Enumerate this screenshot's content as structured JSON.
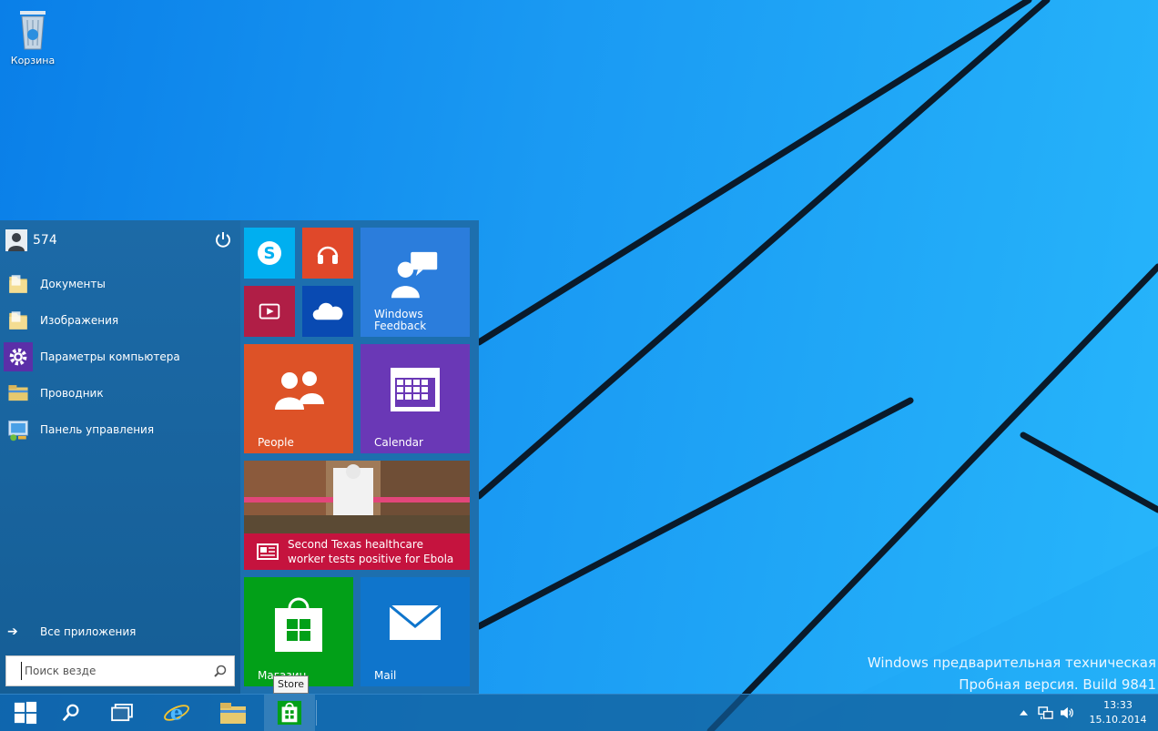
{
  "desktop": {
    "recycle_bin_label": "Корзина",
    "watermark_line1": "Windows предварительная техническая",
    "watermark_line2": "Пробная версия. Build 9841"
  },
  "start_menu": {
    "user_name": "574",
    "items": [
      {
        "label": "Документы",
        "icon": "folder-icon"
      },
      {
        "label": "Изображения",
        "icon": "folder-icon"
      },
      {
        "label": "Параметры компьютера",
        "icon": "gear-icon"
      },
      {
        "label": "Проводник",
        "icon": "file-explorer-icon"
      },
      {
        "label": "Панель управления",
        "icon": "control-panel-icon"
      }
    ],
    "all_apps_label": "Все приложения",
    "search_placeholder": "Поиск везде"
  },
  "tiles": {
    "windows_feedback_line1": "Windows",
    "windows_feedback_line2": "Feedback",
    "people": "People",
    "calendar": "Calendar",
    "news_line1": "Second Texas healthcare",
    "news_line2": "worker tests positive for Ebola",
    "store": "Магазин",
    "mail": "Mail"
  },
  "colors": {
    "skype": "#00aff0",
    "music": "#e0482a",
    "video": "#b01e46",
    "onedrive": "#094ab2",
    "feedback": "#2b7ddc",
    "people": "#dd5227",
    "calendar": "#6a38b6",
    "news": "#c5133e",
    "store": "#02a018",
    "mail": "#0f75cc"
  },
  "tooltip": "Store",
  "taskbar": {
    "time": "13:33",
    "date": "15.10.2014"
  }
}
